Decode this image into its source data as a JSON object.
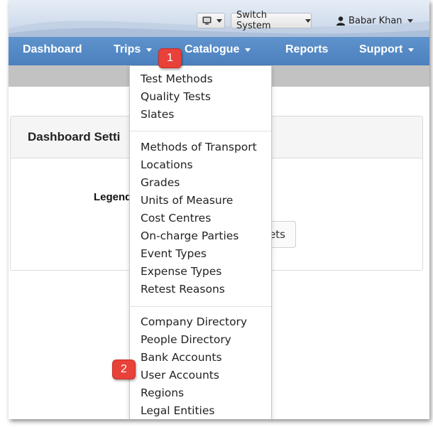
{
  "header": {
    "switch_system_label": "Switch System",
    "user_name": "Babar Khan"
  },
  "nav": {
    "items": [
      {
        "label": "Dashboard",
        "has_caret": false
      },
      {
        "label": "Trips",
        "has_caret": true
      },
      {
        "label": "Catalogue",
        "has_caret": true
      },
      {
        "label": "Reports",
        "has_caret": false
      },
      {
        "label": "Support",
        "has_caret": true
      }
    ]
  },
  "card": {
    "title": "Dashboard Setti",
    "legend_label": "Legend",
    "button_label": "ets"
  },
  "dropdown": {
    "groups": [
      {
        "items": [
          "Test Methods",
          "Quality Tests",
          "Slates"
        ]
      },
      {
        "items": [
          "Methods of Transport",
          "Locations",
          "Grades",
          "Units of Measure",
          "Cost Centres",
          "On-charge Parties",
          "Event Types",
          "Expense Types",
          "Retest Reasons"
        ]
      },
      {
        "items": [
          "Company Directory",
          "People Directory",
          "Bank Accounts",
          "User Accounts",
          "Regions",
          "Legal Entities"
        ]
      }
    ]
  },
  "badges": {
    "first": "1",
    "second": "2"
  },
  "colors": {
    "navbar": "#4f84c3",
    "badge": "#e8413a",
    "grey_strip": "#c2c2c2"
  }
}
